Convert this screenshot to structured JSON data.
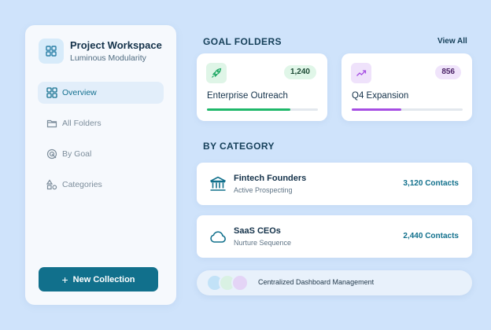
{
  "workspace": {
    "title": "Project Workspace",
    "subtitle": "Luminous Modularity"
  },
  "nav": {
    "items": [
      {
        "label": "Overview",
        "icon": "grid-icon",
        "active": true
      },
      {
        "label": "All Folders",
        "icon": "folder-icon",
        "active": false
      },
      {
        "label": "By Goal",
        "icon": "target-icon",
        "active": false
      },
      {
        "label": "Categories",
        "icon": "shapes-icon",
        "active": false
      }
    ]
  },
  "sidebar": {
    "new_button": "New Collection"
  },
  "goal_folders": {
    "title": "GOAL FOLDERS",
    "view_all": "View All",
    "cards": [
      {
        "name": "Enterprise Outreach",
        "count": "1,240",
        "icon": "rocket-icon",
        "progress": 0.75,
        "accent": "#1fb86a",
        "icon_bg": "#dff5e7",
        "badge_bg": "#e0f6e8",
        "badge_color": "#1c4a34"
      },
      {
        "name": "Q4 Expansion",
        "count": "856",
        "icon": "trending-up-icon",
        "progress": 0.45,
        "accent": "#a64ee3",
        "icon_bg": "#efe2fb",
        "badge_bg": "#f0e4fb",
        "badge_color": "#4a2266"
      }
    ]
  },
  "by_category": {
    "title": "BY CATEGORY",
    "items": [
      {
        "name": "Fintech Founders",
        "status": "Active Prospecting",
        "count": "3,120 Contacts",
        "icon": "bank-icon"
      },
      {
        "name": "SaaS CEOs",
        "status": "Nurture Sequence",
        "count": "2,440 Contacts",
        "icon": "cloud-icon"
      }
    ]
  },
  "footer": {
    "text": "Centralized Dashboard Management"
  },
  "colors": {
    "primary": "#11708c",
    "background": "#cfe3fb"
  }
}
